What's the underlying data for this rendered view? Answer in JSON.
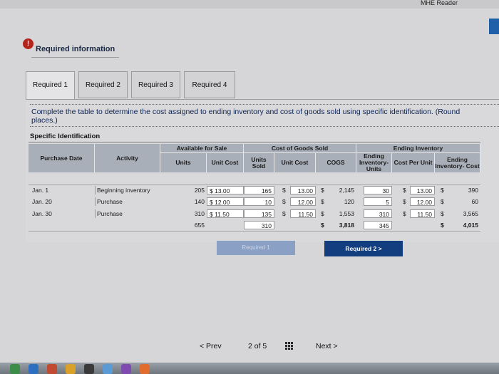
{
  "window": {
    "reader_label": "MHE Reader"
  },
  "header": {
    "alert_icon": "!",
    "required_info": "Required information"
  },
  "tabs": [
    {
      "label": "Required 1"
    },
    {
      "label": "Required 2"
    },
    {
      "label": "Required 3"
    },
    {
      "label": "Required 4"
    }
  ],
  "instructions": {
    "line1": "Complete the table to determine the cost assigned to ending inventory and cost of goods sold using specific identification. (Round",
    "line2": "places.)"
  },
  "table": {
    "title": "Specific Identification",
    "groups": {
      "available": "Available for Sale",
      "cogs": "Cost of Goods Sold",
      "ending": "Ending Inventory"
    },
    "headers": {
      "purchase_date": "Purchase Date",
      "activity": "Activity",
      "units": "Units",
      "unit_cost": "Unit Cost",
      "units_sold": "Units Sold",
      "unit_cost2": "Unit Cost",
      "cogs": "COGS",
      "ending_units": "Ending Inventory- Units",
      "cost_per_unit": "Cost Per Unit",
      "ending_cost": "Ending Inventory- Cost"
    },
    "rows": [
      {
        "date": "Jan. 1",
        "activity": "Beginning inventory",
        "units": "205",
        "unit_cost": "$ 13.00",
        "units_sold": "165",
        "uc_sym": "$",
        "uc_val": "13.00",
        "cogs_sym": "$",
        "cogs_val": "2,145",
        "end_units": "30",
        "cpu_sym": "$",
        "cpu_val": "13.00",
        "end_sym": "$",
        "end_val": "390"
      },
      {
        "date": "Jan. 20",
        "activity": "Purchase",
        "units": "140",
        "unit_cost": "$ 12.00",
        "units_sold": "10",
        "uc_sym": "$",
        "uc_val": "12.00",
        "cogs_sym": "$",
        "cogs_val": "120",
        "end_units": "5",
        "cpu_sym": "$",
        "cpu_val": "12.00",
        "end_sym": "$",
        "end_val": "60"
      },
      {
        "date": "Jan. 30",
        "activity": "Purchase",
        "units": "310",
        "unit_cost": "$ 11.50",
        "units_sold": "135",
        "uc_sym": "$",
        "uc_val": "11.50",
        "cogs_sym": "$",
        "cogs_val": "1,553",
        "end_units": "310",
        "cpu_sym": "$",
        "cpu_val": "11.50",
        "end_sym": "$",
        "end_val": "3,565"
      }
    ],
    "totals": {
      "units": "655",
      "units_sold": "310",
      "cogs_sym": "$",
      "cogs": "3,818",
      "end_units": "345",
      "end_sym": "$",
      "end_cost": "4,015"
    }
  },
  "nav_buttons": {
    "prev_label": "Required 1",
    "next_label": "Required 2  >"
  },
  "pager": {
    "prev": "< Prev",
    "page": "2 of 5",
    "next": "Next >"
  }
}
